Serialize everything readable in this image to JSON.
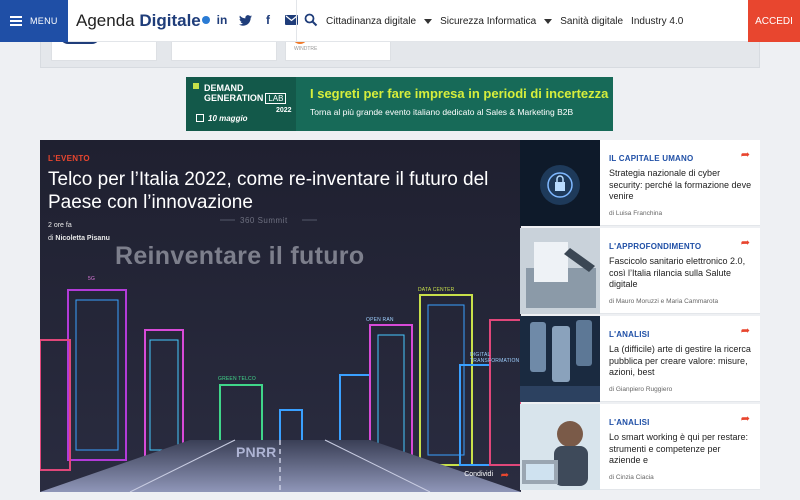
{
  "header": {
    "menu_label": "MENU",
    "logo_part1": "Agenda",
    "logo_part2": "Digitale",
    "social": [
      {
        "icon": "linkedin-icon",
        "glyph": "in"
      },
      {
        "icon": "twitter-icon",
        "glyph": "t"
      },
      {
        "icon": "facebook-icon",
        "glyph": "f"
      },
      {
        "icon": "mail-icon",
        "glyph": "✉"
      }
    ],
    "nav": [
      "Cittadinanza digitale",
      "Sicurezza Informatica",
      "Sanità digitale",
      "Industry 4.0"
    ],
    "login_label": "ACCEDI",
    "colors": {
      "primary": "#1f4fa6",
      "accent": "#e8462f"
    }
  },
  "partners": {
    "card3_brand": "WINDTRE"
  },
  "banner": {
    "brand_line1": "DEMAND",
    "brand_line2": "GENERATION",
    "brand_lab": "LAB",
    "brand_year": "2022",
    "date": "10 maggio",
    "headline": "I segreti per fare impresa in periodi di incertezza",
    "subline": "Torna al più grande evento italiano dedicato al Sales & Marketing B2B"
  },
  "hero": {
    "kicker": "L'EVENTO",
    "title": "Telco per l’Italia 2022, come re-inventare il futuro del Paese con l’innovazione",
    "time": "2 ore fa",
    "by": "di",
    "author": "Nicoletta Pisanu",
    "image_small_text": "360 Summit",
    "image_big_text": "Reinventare il futuro",
    "image_labels": [
      "5G",
      "GREEN TELCO",
      "DATA CENTER",
      "OPEN RAN",
      "DIGITAL TRANSFORMATION",
      "PNRR"
    ],
    "share_label": "Condividi"
  },
  "articles": [
    {
      "category": "IL CAPITALE UMANO",
      "title": "Strategia nazionale di cyber security: perché la formazione deve venire",
      "author": "di Luisa Franchina"
    },
    {
      "category": "L'APPROFONDIMENTO",
      "title": "Fascicolo sanitario elettronico 2.0, così l’Italia rilancia sulla Salute digitale",
      "author": "di Mauro Moruzzi e Maria Cammarota"
    },
    {
      "category": "L'ANALISI",
      "title": "La (difficile) arte di gestire la ricerca pubblica per creare valore: misure, azioni, best",
      "author": "di Gianpiero Ruggiero"
    },
    {
      "category": "L'ANALISI",
      "title": "Lo smart working è qui per restare: strumenti e competenze per aziende e",
      "author": "di Cinzia Ciacia"
    }
  ]
}
